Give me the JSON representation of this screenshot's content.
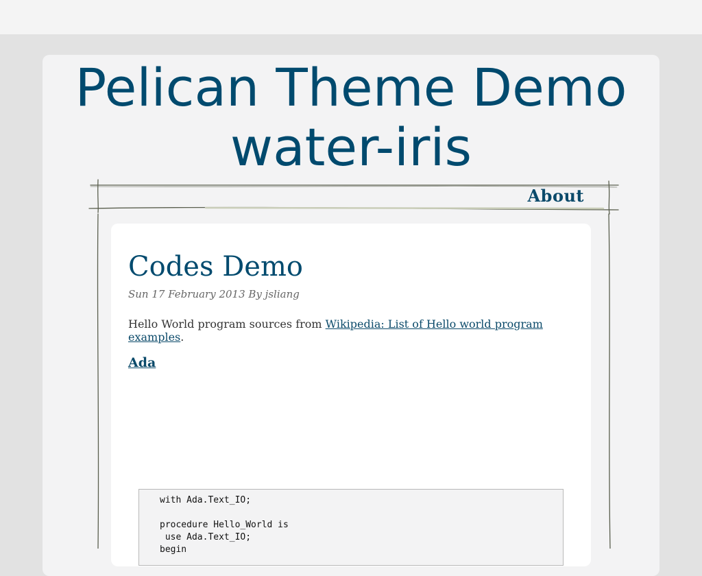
{
  "site": {
    "title_line1": "Pelican Theme Demo",
    "title_line2": "water-iris"
  },
  "nav": {
    "items": [
      {
        "label": "About"
      }
    ]
  },
  "article": {
    "title": "Codes Demo",
    "meta": "Sun 17 February 2013 By jsliang",
    "intro_text": "Hello World program sources from ",
    "intro_link": "Wikipedia: List of Hello world program examples",
    "intro_end": ".",
    "section_heading": "Ada",
    "code_lines": [
      "with Ada.Text_IO;",
      "",
      "procedure Hello_World is",
      " use Ada.Text_IO;",
      "begin"
    ]
  },
  "colors": {
    "title": "#004a6e",
    "link": "#0b4a6a",
    "background": "#e2e2e2",
    "panel": "#f3f3f4"
  }
}
